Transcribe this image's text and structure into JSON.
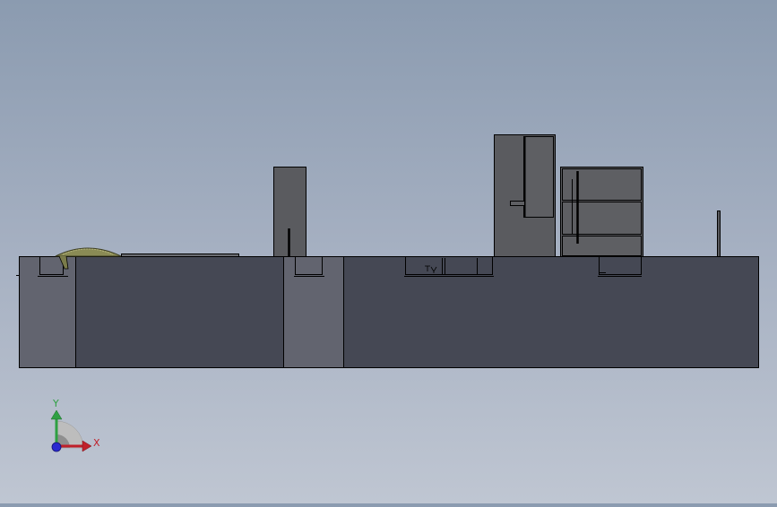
{
  "viewport": {
    "background_top": "#8b9bb0",
    "background_bottom": "#bfc6d2"
  },
  "model": {
    "dark_face_color": "#454854",
    "light_face_color": "#62646f",
    "component_color": "#5a5b5f",
    "mesh_color": "#8a8b55",
    "edge_color": "#000000"
  },
  "triad": {
    "x_label": "X",
    "y_label": "Y",
    "x_color": "#c0202a",
    "y_color": "#2ea043",
    "z_color": "#2a2ad0"
  }
}
